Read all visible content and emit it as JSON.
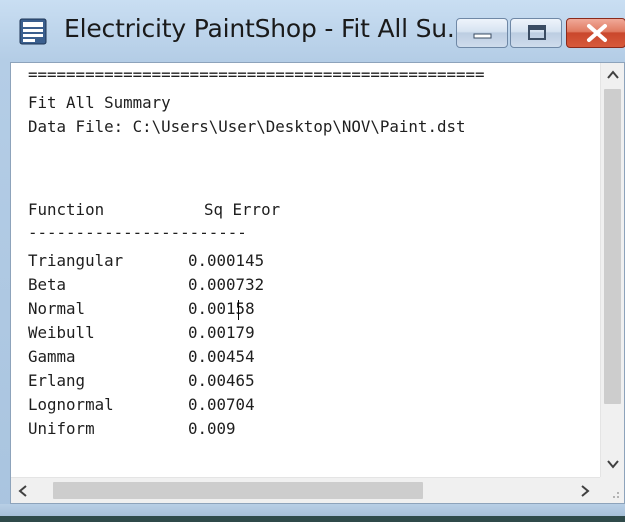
{
  "window": {
    "title": "Electricity PaintShop - Fit All Su...",
    "app_icon": "notepad-window-icon",
    "controls": {
      "minimize": "minimize-icon",
      "maximize": "maximize-icon",
      "close": "close-icon"
    },
    "colors": {
      "frame": "#b4cde6",
      "close_button": "#c9472c"
    }
  },
  "document": {
    "separator_top": "================================================",
    "heading": "Fit All Summary",
    "data_file": "Data File: C:\\Users\\User\\Desktop\\NOV\\Paint.dst",
    "columns": {
      "function": "Function",
      "sq_error": "Sq Error"
    },
    "column_rule": "-----------------------",
    "rows": [
      {
        "function": "Triangular",
        "sq_error": "0.000145"
      },
      {
        "function": "Beta",
        "sq_error": "0.000732"
      },
      {
        "function": "Normal",
        "sq_error": "0.00158"
      },
      {
        "function": "Weibull",
        "sq_error": "0.00179"
      },
      {
        "function": "Gamma",
        "sq_error": "0.00454"
      },
      {
        "function": "Erlang",
        "sq_error": "0.00465"
      },
      {
        "function": "Lognormal",
        "sq_error": "0.00704"
      },
      {
        "function": "Uniform",
        "sq_error": "0.009"
      }
    ]
  },
  "scrollbars": {
    "vertical": {
      "up": "scroll-up-arrow-icon",
      "down": "scroll-down-arrow-icon"
    },
    "horizontal": {
      "left": "scroll-left-arrow-icon",
      "right": "scroll-right-arrow-icon"
    }
  }
}
